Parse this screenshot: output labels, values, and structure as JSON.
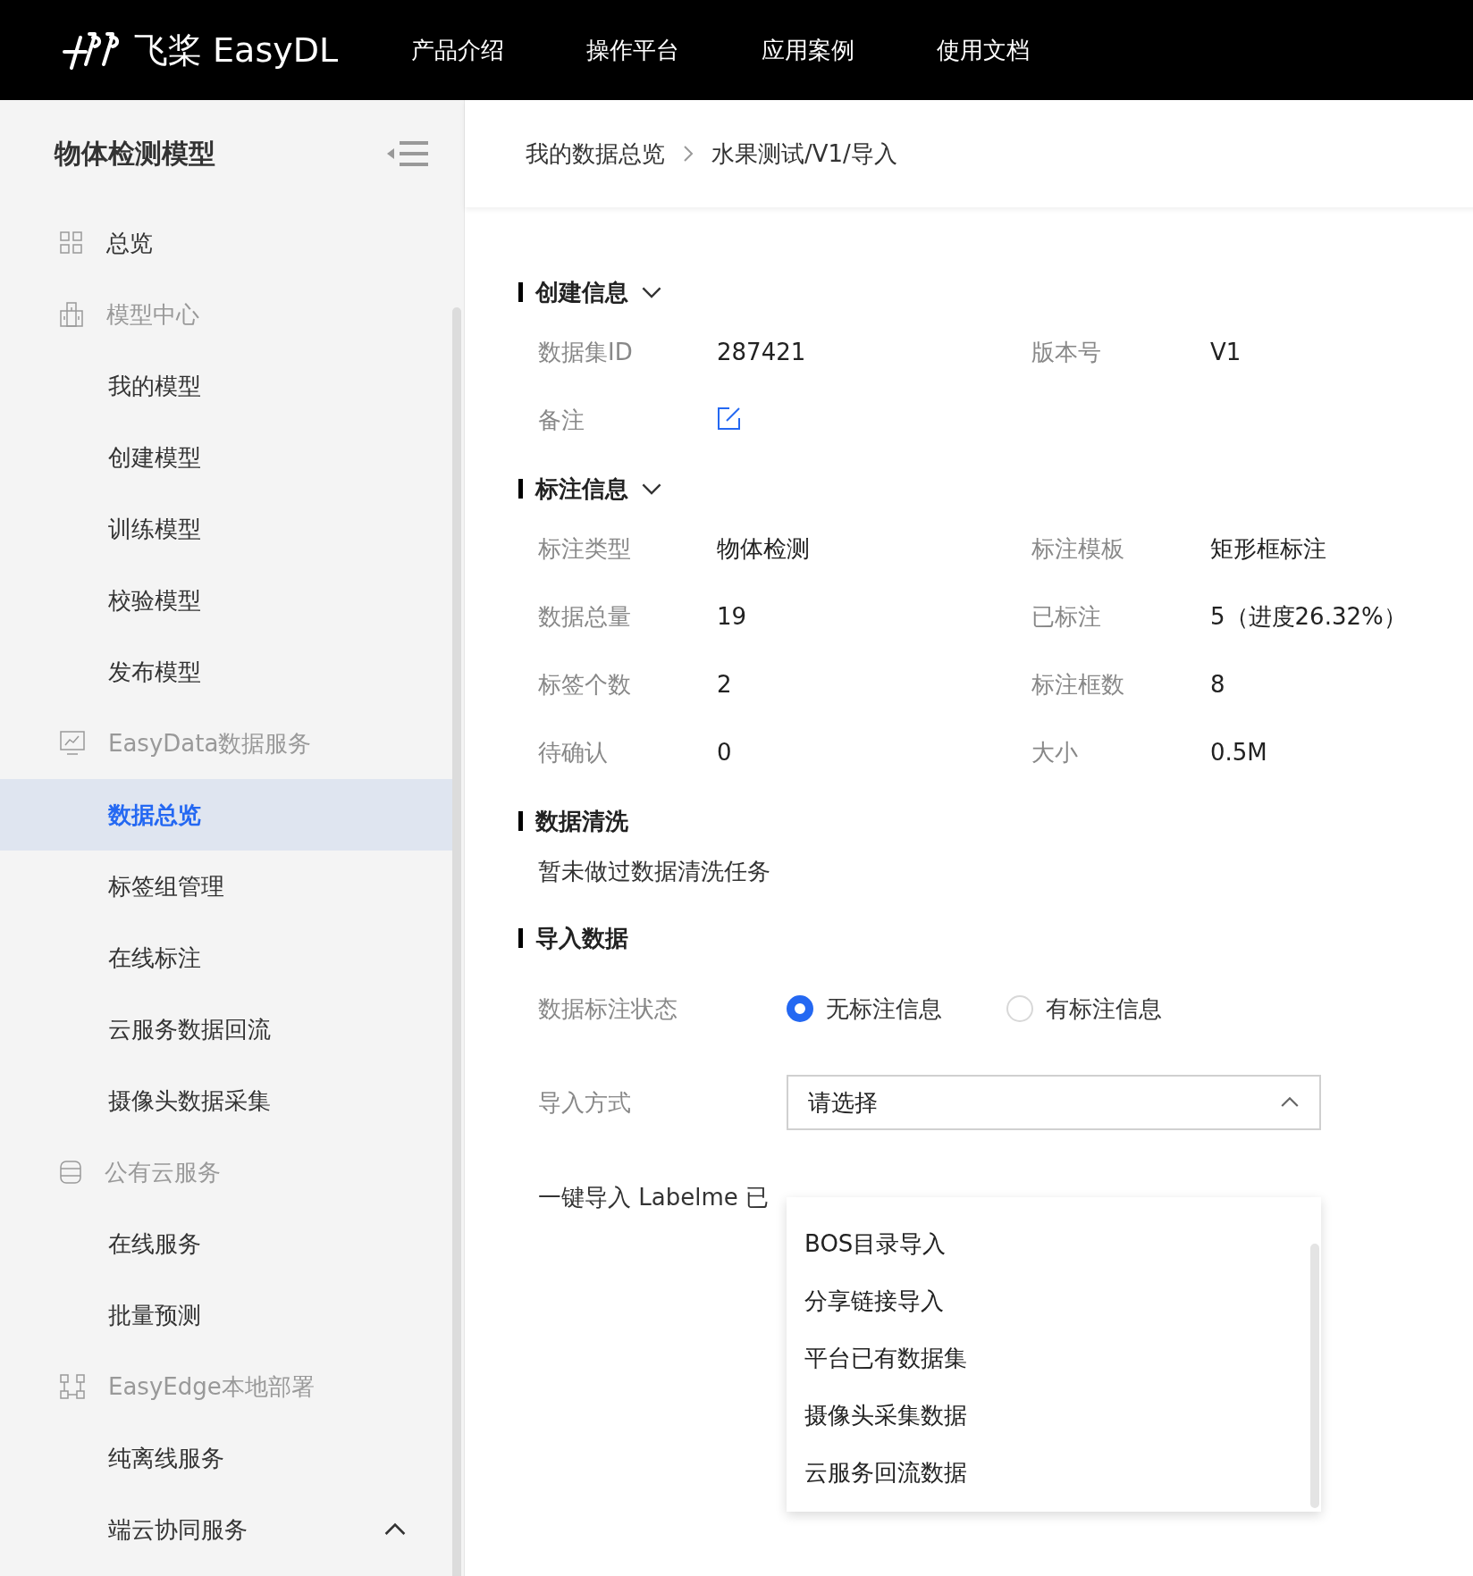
{
  "header": {
    "logo": "飞桨 EasyDL",
    "nav": [
      {
        "label": "产品介绍"
      },
      {
        "label": "操作平台"
      },
      {
        "label": "应用案例"
      },
      {
        "label": "使用文档"
      }
    ]
  },
  "sidebar": {
    "title": "物体检测模型",
    "items": [
      {
        "label": "总览",
        "kind": "link",
        "selected": false
      },
      {
        "label": "模型中心",
        "kind": "group",
        "children": [
          {
            "label": "我的模型",
            "selected": false
          },
          {
            "label": "创建模型",
            "selected": false
          },
          {
            "label": "训练模型",
            "selected": false
          },
          {
            "label": "校验模型",
            "selected": false
          },
          {
            "label": "发布模型",
            "selected": false
          }
        ]
      },
      {
        "label": "EasyData数据服务",
        "kind": "group",
        "children": [
          {
            "label": "数据总览",
            "selected": true
          },
          {
            "label": "标签组管理",
            "selected": false
          },
          {
            "label": "在线标注",
            "selected": false
          },
          {
            "label": "云服务数据回流",
            "selected": false
          },
          {
            "label": "摄像头数据采集",
            "selected": false
          }
        ]
      },
      {
        "label": "公有云服务",
        "kind": "group",
        "children": [
          {
            "label": "在线服务",
            "selected": false
          },
          {
            "label": "批量预测",
            "selected": false
          }
        ]
      },
      {
        "label": "EasyEdge本地部署",
        "kind": "group",
        "children": [
          {
            "label": "纯离线服务",
            "selected": false
          },
          {
            "label": "端云协同服务",
            "selected": false,
            "expanded": true
          }
        ]
      }
    ]
  },
  "breadcrumb": [
    "我的数据总览",
    "水果测试/V1/导入"
  ],
  "sections": [
    {
      "title": "创建信息",
      "expanded": true,
      "fields": [
        {
          "label": "数据集ID",
          "value": "287421",
          "kind": "text"
        },
        {
          "label": "版本号",
          "value": "V1",
          "kind": "text"
        },
        {
          "label": "备注",
          "kind": "edit"
        }
      ]
    },
    {
      "title": "标注信息",
      "expanded": true,
      "fields": [
        {
          "label": "标注类型",
          "value": "物体检测",
          "kind": "text"
        },
        {
          "label": "标注模板",
          "value": "矩形框标注",
          "kind": "text"
        },
        {
          "label": "数据总量",
          "value": "19",
          "kind": "text"
        },
        {
          "label": "已标注",
          "value": "5（进度26.32%）",
          "kind": "text"
        },
        {
          "label": "标签个数",
          "value": "2",
          "kind": "text"
        },
        {
          "label": "标注框数",
          "value": "8",
          "kind": "text"
        },
        {
          "label": "待确认",
          "value": "0",
          "kind": "text"
        },
        {
          "label": "大小",
          "value": "0.5M",
          "kind": "text"
        }
      ]
    },
    {
      "title": "数据清洗",
      "note": "暂未做过数据清洗任务"
    }
  ],
  "import": {
    "title": "导入数据",
    "status_label": "数据标注状态",
    "radios": [
      {
        "label": "无标注信息",
        "selected": true
      },
      {
        "label": "有标注信息",
        "selected": false
      }
    ],
    "method_label": "导入方式",
    "select": {
      "placeholder": "请选择",
      "expanded": true,
      "options": [
        "BOS目录导入",
        "分享链接导入",
        "平台已有数据集",
        "摄像头采集数据",
        "云服务回流数据"
      ]
    },
    "hint": "一键导入 Labelme 已"
  }
}
